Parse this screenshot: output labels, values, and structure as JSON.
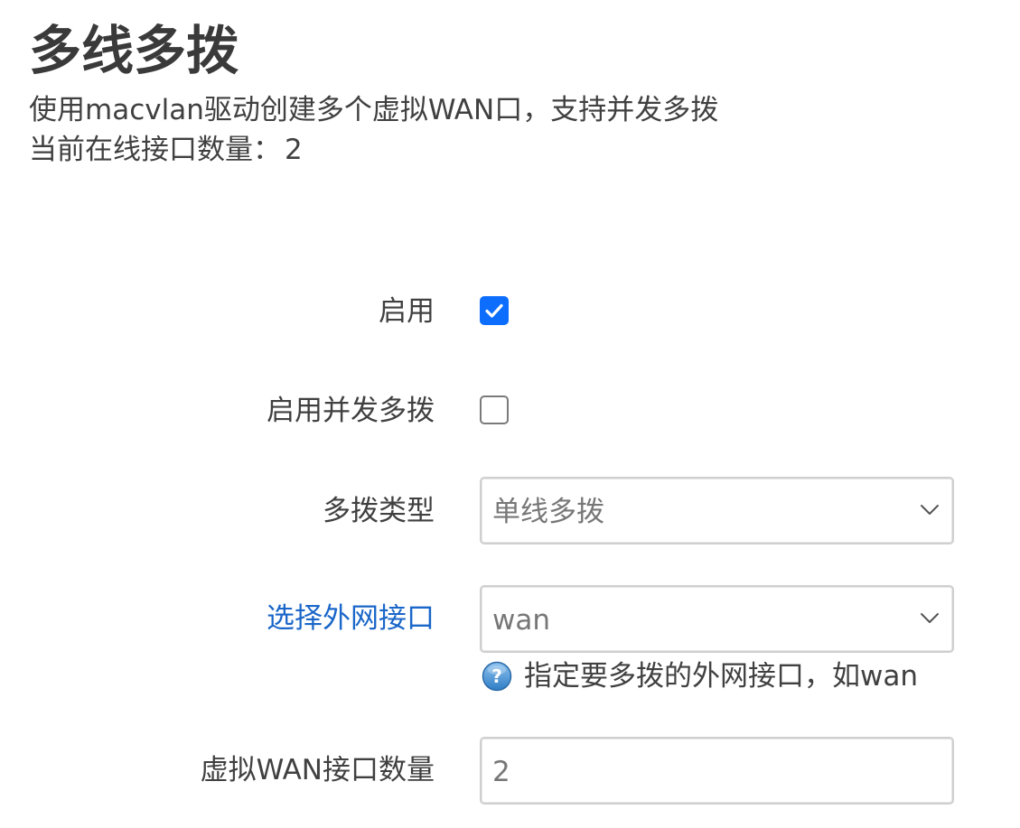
{
  "page": {
    "title": "多线多拨",
    "description": "使用macvlan驱动创建多个虚拟WAN口，支持并发多拨",
    "online_label": "当前在线接口数量：",
    "online_count": "2"
  },
  "form": {
    "enable": {
      "label": "启用",
      "checked": true
    },
    "concurrent": {
      "label": "启用并发多拨",
      "checked": false
    },
    "dial_type": {
      "label": "多拨类型",
      "value": "单线多拨"
    },
    "wan_interface": {
      "label": "选择外网接口",
      "value": "wan",
      "hint": "指定要多拨的外网接口，如wan"
    },
    "wan_count": {
      "label": "虚拟WAN接口数量",
      "value": "2"
    }
  },
  "colors": {
    "accent": "#0d6efd",
    "link": "#1a66c9",
    "text": "#404040"
  },
  "icons": {
    "checkbox_check": "check-icon",
    "select_arrow": "chevron-down-icon",
    "help": "help-icon"
  }
}
